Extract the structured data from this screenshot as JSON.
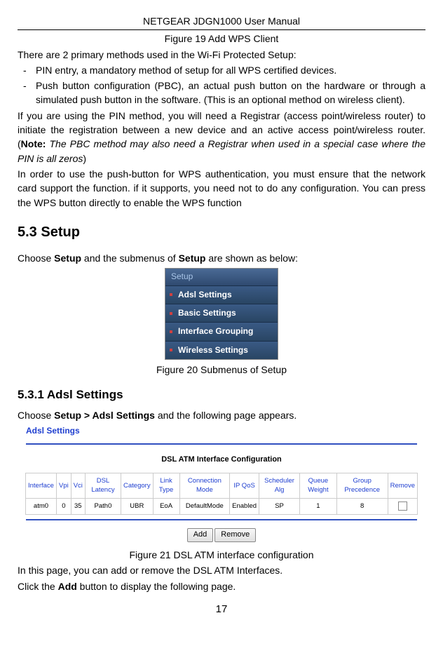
{
  "header": "NETGEAR JDGN1000 User Manual",
  "fig19": "Figure 19 Add WPS Client",
  "intro": "There are 2 primary methods used in the Wi-Fi Protected Setup:",
  "bullet1": "PIN entry, a mandatory method of setup for all WPS certified devices.",
  "bullet2": "Push button configuration (PBC), an actual push button on the hardware or through a simulated push button in the software. (This is an optional method on wireless client).",
  "para1a": "If you are using the PIN method, you will need a Registrar (access point/wireless router) to initiate the registration between a new device and an active access point/wireless router. (",
  "para1note": "Note:",
  "para1b": " The PBC method may also need a Registrar when used in a special case where the PIN is all zeros",
  "para1c": ")",
  "para2": "In order to use the push-button for WPS authentication, you must ensure that the network card support the function. if it supports, you need not to do any configuration. You can press the WPS button directly to enable the WPS function",
  "h53": "5.3  Setup",
  "setup_intro_a": "Choose ",
  "setup_intro_b": "Setup",
  "setup_intro_c": " and the submenus of ",
  "setup_intro_d": "Setup",
  "setup_intro_e": " are shown as below:",
  "menu": {
    "header": "Setup",
    "items": [
      "Adsl Settings",
      "Basic Settings",
      "Interface Grouping",
      "Wireless Settings"
    ]
  },
  "fig20": "Figure 20 Submenus of Setup",
  "h531": "5.3.1   Adsl Settings",
  "adsl_intro_a": "Choose ",
  "adsl_intro_b": "Setup > Adsl Settings",
  "adsl_intro_c": " and the following page appears.",
  "adsl_title": "Adsl Settings",
  "config_title": "DSL ATM Interface Configuration",
  "table": {
    "headers": [
      "Interface",
      "Vpi",
      "Vci",
      "DSL Latency",
      "Category",
      "Link Type",
      "Connection Mode",
      "IP QoS",
      "Scheduler Alg",
      "Queue Weight",
      "Group Precedence",
      "Remove"
    ],
    "row": [
      "atm0",
      "0",
      "35",
      "Path0",
      "UBR",
      "EoA",
      "DefaultMode",
      "Enabled",
      "SP",
      "1",
      "8",
      ""
    ]
  },
  "buttons": {
    "add": "Add",
    "remove": "Remove"
  },
  "fig21": "Figure 21 DSL ATM interface configuration",
  "para3": "In this page, you can add or remove the DSL ATM Interfaces.",
  "para4a": "Click the ",
  "para4b": "Add",
  "para4c": " button to display the following page.",
  "page_num": "17"
}
